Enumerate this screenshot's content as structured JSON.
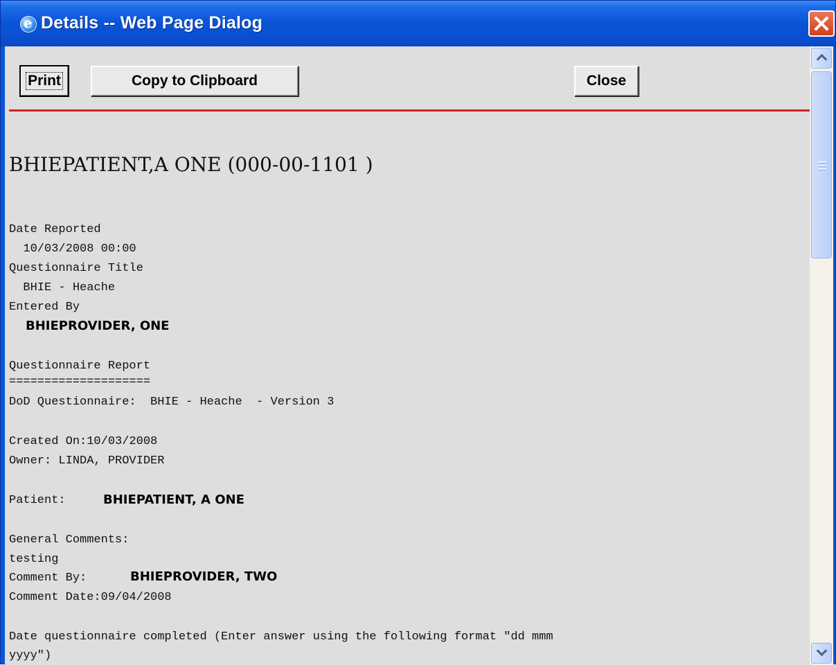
{
  "window": {
    "title": "Details -- Web Page Dialog",
    "icon": "ie-page-icon"
  },
  "toolbar": {
    "print_label": "Print",
    "copy_label": "Copy to Clipboard",
    "close_label": "Close"
  },
  "report": {
    "patient_header": "BHIEPATIENT,A ONE (000-00-1101 )",
    "date_reported_label": "Date Reported",
    "date_reported_value": "  10/03/2008 00:00",
    "questionnaire_title_label": "Questionnaire Title",
    "questionnaire_title_value": "  BHIE - Heache",
    "entered_by_label": "Entered By",
    "entered_by_value": "BHIEPROVIDER, ONE",
    "questionnaire_report_label": "Questionnaire Report",
    "separator": "====================",
    "dod_line": "DoD Questionnaire:  BHIE - Heache  - Version 3",
    "created_on": "Created On:10/03/2008",
    "owner": "Owner: LINDA, PROVIDER",
    "patient_label": "Patient:",
    "patient_value": "BHIEPATIENT, A ONE",
    "general_comments_label": "General Comments:",
    "general_comments_value": "testing",
    "comment_by_label": "Comment By:",
    "comment_by_value": "BHIEPROVIDER, TWO",
    "comment_date": "Comment Date:09/04/2008",
    "question_line1": "Date questionnaire completed (Enter answer using the following format \"dd mmm",
    "question_line2": "yyyy\")"
  },
  "colors": {
    "title_bar": "#0a55d8",
    "rule": "#cc2222",
    "background": "#dedede"
  }
}
